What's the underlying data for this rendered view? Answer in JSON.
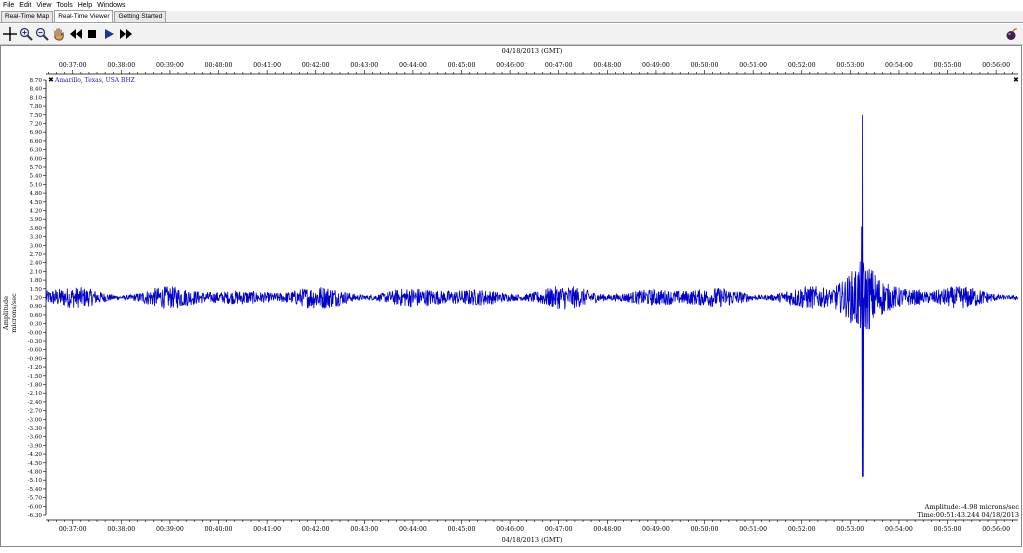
{
  "menu": {
    "items": [
      "File",
      "Edit",
      "View",
      "Tools",
      "Help",
      "Windows"
    ]
  },
  "tabs": [
    {
      "label": "Real-Time Map",
      "active": false
    },
    {
      "label": "Real-Time Viewer",
      "active": true
    },
    {
      "label": "Getting Started",
      "active": false
    }
  ],
  "toolbar": {
    "icons": [
      "crosshair-icon",
      "zoom-in-icon",
      "zoom-out-icon",
      "pan-hand-icon",
      "rewind-icon",
      "stop-icon",
      "play-icon",
      "fast-forward-icon",
      "bomb-icon"
    ]
  },
  "plot": {
    "date_label": "04/18/2013 (GMT)",
    "station": "Amarillo, Texas, USA BHZ",
    "ylabel_line1": "Amplitude",
    "ylabel_line2": "microns/sec",
    "readout_amplitude": "Amplitude:-4.98 microns/sec",
    "readout_time": "Time:00:51:43.244 04/18/2013",
    "close_glyph": "✖"
  },
  "chart_data": {
    "type": "line",
    "x_ticks": [
      "00:37:00",
      "00:38:00",
      "00:39:00",
      "00:40:00",
      "00:41:00",
      "00:42:00",
      "00:43:00",
      "00:44:00",
      "00:45:00",
      "00:46:00",
      "00:47:00",
      "00:48:00",
      "00:49:00",
      "00:50:00",
      "00:51:00",
      "00:52:00",
      "00:53:00",
      "00:54:00",
      "00:55:00",
      "00:56:00"
    ],
    "y_ticks": [
      "8.70",
      "8.40",
      "8.10",
      "7.80",
      "7.50",
      "7.20",
      "6.90",
      "6.60",
      "6.30",
      "6.00",
      "5.70",
      "5.40",
      "5.10",
      "4.80",
      "4.50",
      "4.20",
      "3.90",
      "3.60",
      "3.30",
      "3.00",
      "2.70",
      "2.40",
      "2.10",
      "1.80",
      "1.50",
      "1.20",
      "0.90",
      "0.60",
      "0.30",
      "-0.00",
      "-0.30",
      "-0.60",
      "-0.90",
      "-1.20",
      "-1.50",
      "-1.80",
      "-2.10",
      "-2.40",
      "-2.70",
      "-3.00",
      "-3.30",
      "-3.60",
      "-3.90",
      "-4.20",
      "-4.50",
      "-4.80",
      "-5.10",
      "-5.40",
      "-5.70",
      "-6.00",
      "-6.30"
    ],
    "ylim": [
      -6.3,
      8.7
    ],
    "xlim_minutes": [
      36.45,
      56.45
    ],
    "baseline": 1.2,
    "noise_amplitude": 0.35,
    "event": {
      "peak_time_minutes": 53.25,
      "max": 7.5,
      "min": -4.98
    },
    "series_color": "#0000cc"
  }
}
